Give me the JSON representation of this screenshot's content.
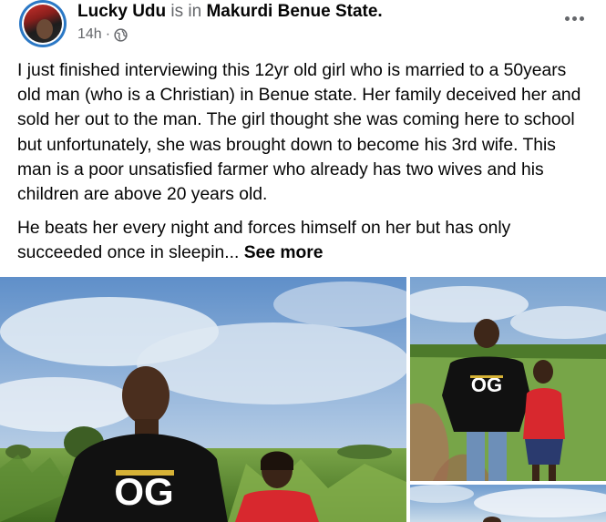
{
  "post": {
    "author": "Lucky Udu",
    "is_in": "is in",
    "location": "Makurdi Benue State.",
    "time": "14h",
    "separator": "·",
    "privacy_icon": "globe-icon",
    "more_icon": "more-options-icon",
    "paragraph1": "I just finished interviewing this 12yr old girl who is married to a 50years old man (who is a Christian) in Benue state. Her family deceived her and sold her out to the man. The girl thought she was coming here to school but unfortunately, she was brought down to become his 3rd wife. This man is a poor unsatisfied farmer who already has two wives and his children are above 20 years old.",
    "paragraph2": "He beats her every night and forces himself on her but has only succeeded once in sleepin...",
    "see_more": "See more"
  },
  "photos": {
    "shirt_logo": "OG",
    "colors": {
      "sky": "#8fb6dc",
      "grass": "#6f9a3a",
      "shirt": "#111111",
      "dress": "#d8282e"
    }
  }
}
